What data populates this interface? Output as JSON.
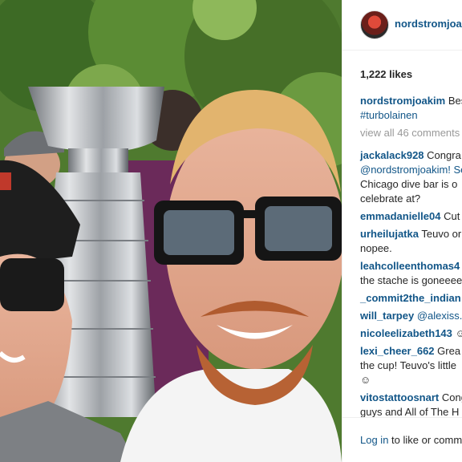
{
  "post": {
    "username": "nordstromjoakim",
    "likes": "1,222 likes",
    "caption": {
      "user": "nordstromjoakim",
      "text": "Bes",
      "hashtag": "#turbolainen"
    },
    "view_all": "view all 46 comments",
    "comments": [
      {
        "user": "jackalack928",
        "lines": [
          "Congra",
          "@nordstromjoakim! Se",
          "Chicago dive bar is o",
          "celebrate at?"
        ]
      },
      {
        "user": "emmadanielle04",
        "lines": [
          "Cut"
        ]
      },
      {
        "user": "urheilujatka",
        "lines": [
          "Teuvo or",
          "nopee."
        ]
      },
      {
        "user": "leahcolleenthomas4",
        "lines": [
          "",
          "the stache is goneeee"
        ]
      },
      {
        "user": "_commit2the_indian",
        "lines": [
          ""
        ]
      },
      {
        "user": "will_tarpey",
        "lines": [
          "@alexiss."
        ]
      },
      {
        "user": "nicoleelizabeth143",
        "lines": [
          "☺"
        ]
      },
      {
        "user": "lexi_cheer_662",
        "lines": [
          "Grea",
          "the cup! Teuvo's little",
          "☺"
        ]
      },
      {
        "user": "vitostattoosnart",
        "lines": [
          "Cong",
          "guys and All of The H"
        ]
      }
    ],
    "login_link": "Log in",
    "login_rest": " to like or comm"
  }
}
